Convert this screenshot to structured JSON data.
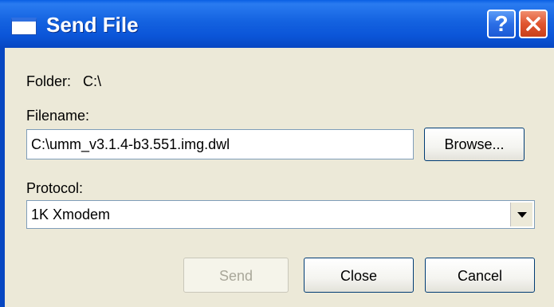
{
  "window": {
    "title": "Send File"
  },
  "folder": {
    "label": "Folder:",
    "value": "C:\\"
  },
  "filename": {
    "label": "Filename:",
    "value": "C:\\umm_v3.1.4-b3.551.img.dwl"
  },
  "browse_label": "Browse...",
  "protocol": {
    "label": "Protocol:",
    "selected": "1K Xmodem"
  },
  "buttons": {
    "send": "Send",
    "close": "Close",
    "cancel": "Cancel"
  },
  "titlebar_buttons": {
    "help": "?"
  },
  "colors": {
    "titlebar": "#0b55d8",
    "window_bg": "#ece9d8",
    "close_red": "#e0552f"
  }
}
